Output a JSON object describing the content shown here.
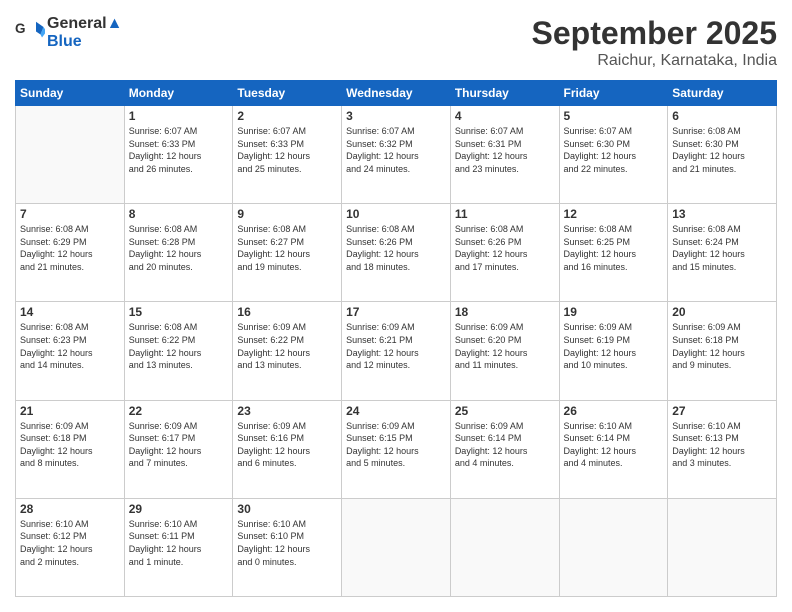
{
  "logo": {
    "line1": "General",
    "line2": "Blue"
  },
  "header": {
    "month": "September 2025",
    "location": "Raichur, Karnataka, India"
  },
  "weekdays": [
    "Sunday",
    "Monday",
    "Tuesday",
    "Wednesday",
    "Thursday",
    "Friday",
    "Saturday"
  ],
  "weeks": [
    [
      {
        "day": "",
        "info": ""
      },
      {
        "day": "1",
        "info": "Sunrise: 6:07 AM\nSunset: 6:33 PM\nDaylight: 12 hours\nand 26 minutes."
      },
      {
        "day": "2",
        "info": "Sunrise: 6:07 AM\nSunset: 6:33 PM\nDaylight: 12 hours\nand 25 minutes."
      },
      {
        "day": "3",
        "info": "Sunrise: 6:07 AM\nSunset: 6:32 PM\nDaylight: 12 hours\nand 24 minutes."
      },
      {
        "day": "4",
        "info": "Sunrise: 6:07 AM\nSunset: 6:31 PM\nDaylight: 12 hours\nand 23 minutes."
      },
      {
        "day": "5",
        "info": "Sunrise: 6:07 AM\nSunset: 6:30 PM\nDaylight: 12 hours\nand 22 minutes."
      },
      {
        "day": "6",
        "info": "Sunrise: 6:08 AM\nSunset: 6:30 PM\nDaylight: 12 hours\nand 21 minutes."
      }
    ],
    [
      {
        "day": "7",
        "info": "Sunrise: 6:08 AM\nSunset: 6:29 PM\nDaylight: 12 hours\nand 21 minutes."
      },
      {
        "day": "8",
        "info": "Sunrise: 6:08 AM\nSunset: 6:28 PM\nDaylight: 12 hours\nand 20 minutes."
      },
      {
        "day": "9",
        "info": "Sunrise: 6:08 AM\nSunset: 6:27 PM\nDaylight: 12 hours\nand 19 minutes."
      },
      {
        "day": "10",
        "info": "Sunrise: 6:08 AM\nSunset: 6:26 PM\nDaylight: 12 hours\nand 18 minutes."
      },
      {
        "day": "11",
        "info": "Sunrise: 6:08 AM\nSunset: 6:26 PM\nDaylight: 12 hours\nand 17 minutes."
      },
      {
        "day": "12",
        "info": "Sunrise: 6:08 AM\nSunset: 6:25 PM\nDaylight: 12 hours\nand 16 minutes."
      },
      {
        "day": "13",
        "info": "Sunrise: 6:08 AM\nSunset: 6:24 PM\nDaylight: 12 hours\nand 15 minutes."
      }
    ],
    [
      {
        "day": "14",
        "info": "Sunrise: 6:08 AM\nSunset: 6:23 PM\nDaylight: 12 hours\nand 14 minutes."
      },
      {
        "day": "15",
        "info": "Sunrise: 6:08 AM\nSunset: 6:22 PM\nDaylight: 12 hours\nand 13 minutes."
      },
      {
        "day": "16",
        "info": "Sunrise: 6:09 AM\nSunset: 6:22 PM\nDaylight: 12 hours\nand 13 minutes."
      },
      {
        "day": "17",
        "info": "Sunrise: 6:09 AM\nSunset: 6:21 PM\nDaylight: 12 hours\nand 12 minutes."
      },
      {
        "day": "18",
        "info": "Sunrise: 6:09 AM\nSunset: 6:20 PM\nDaylight: 12 hours\nand 11 minutes."
      },
      {
        "day": "19",
        "info": "Sunrise: 6:09 AM\nSunset: 6:19 PM\nDaylight: 12 hours\nand 10 minutes."
      },
      {
        "day": "20",
        "info": "Sunrise: 6:09 AM\nSunset: 6:18 PM\nDaylight: 12 hours\nand 9 minutes."
      }
    ],
    [
      {
        "day": "21",
        "info": "Sunrise: 6:09 AM\nSunset: 6:18 PM\nDaylight: 12 hours\nand 8 minutes."
      },
      {
        "day": "22",
        "info": "Sunrise: 6:09 AM\nSunset: 6:17 PM\nDaylight: 12 hours\nand 7 minutes."
      },
      {
        "day": "23",
        "info": "Sunrise: 6:09 AM\nSunset: 6:16 PM\nDaylight: 12 hours\nand 6 minutes."
      },
      {
        "day": "24",
        "info": "Sunrise: 6:09 AM\nSunset: 6:15 PM\nDaylight: 12 hours\nand 5 minutes."
      },
      {
        "day": "25",
        "info": "Sunrise: 6:09 AM\nSunset: 6:14 PM\nDaylight: 12 hours\nand 4 minutes."
      },
      {
        "day": "26",
        "info": "Sunrise: 6:10 AM\nSunset: 6:14 PM\nDaylight: 12 hours\nand 4 minutes."
      },
      {
        "day": "27",
        "info": "Sunrise: 6:10 AM\nSunset: 6:13 PM\nDaylight: 12 hours\nand 3 minutes."
      }
    ],
    [
      {
        "day": "28",
        "info": "Sunrise: 6:10 AM\nSunset: 6:12 PM\nDaylight: 12 hours\nand 2 minutes."
      },
      {
        "day": "29",
        "info": "Sunrise: 6:10 AM\nSunset: 6:11 PM\nDaylight: 12 hours\nand 1 minute."
      },
      {
        "day": "30",
        "info": "Sunrise: 6:10 AM\nSunset: 6:10 PM\nDaylight: 12 hours\nand 0 minutes."
      },
      {
        "day": "",
        "info": ""
      },
      {
        "day": "",
        "info": ""
      },
      {
        "day": "",
        "info": ""
      },
      {
        "day": "",
        "info": ""
      }
    ]
  ]
}
